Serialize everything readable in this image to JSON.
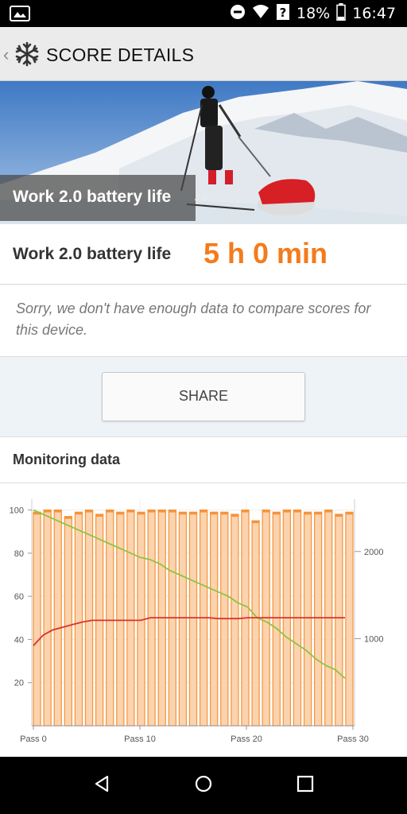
{
  "status_bar": {
    "battery_percent": "18%",
    "time": "16:47"
  },
  "app_bar": {
    "title": "SCORE DETAILS",
    "back_icon": "chevron-left-icon",
    "logo_icon": "snowflake-icon"
  },
  "hero": {
    "caption": "Work 2.0 battery life",
    "version": "2.0"
  },
  "result": {
    "label": "Work 2.0 battery life",
    "value": "5 h 0 min",
    "value_color": "#f47b1c"
  },
  "notice": {
    "text": "Sorry, we don't have enough data to compare scores for this device."
  },
  "share_button": {
    "label": "SHARE"
  },
  "monitoring": {
    "heading": "Monitoring data"
  },
  "chart_data": {
    "type": "bar",
    "x_tick_labels": [
      "Pass 0",
      "Pass 10",
      "Pass 20",
      "Pass 30"
    ],
    "left_axis": {
      "ticks": [
        20,
        40,
        60,
        80,
        100
      ],
      "ylim": [
        0,
        105
      ]
    },
    "right_axis": {
      "ticks": [
        1000,
        2000
      ],
      "ylim": [
        0,
        2600
      ]
    },
    "series": [
      {
        "type": "bar",
        "color": "#f5933a",
        "axis": "left",
        "values": [
          99,
          100,
          100,
          97,
          99,
          100,
          98,
          100,
          99,
          100,
          99,
          100,
          100,
          100,
          99,
          99,
          100,
          99,
          99,
          98,
          100,
          95,
          100,
          99,
          100,
          100,
          99,
          99,
          100,
          98,
          99
        ]
      },
      {
        "type": "line",
        "color": "#8cc63f",
        "axis": "left",
        "values": [
          100,
          98,
          96,
          94,
          92,
          90,
          88,
          86,
          84,
          82,
          80,
          78,
          77,
          75,
          72,
          70,
          68,
          66,
          64,
          62,
          60,
          57,
          55,
          50,
          48,
          45,
          41,
          38,
          35,
          31,
          28,
          26,
          22
        ]
      },
      {
        "type": "line",
        "color": "#d9342b",
        "axis": "right",
        "values": [
          920,
          1040,
          1100,
          1130,
          1160,
          1190,
          1210,
          1210,
          1210,
          1210,
          1210,
          1210,
          1240,
          1240,
          1240,
          1240,
          1240,
          1240,
          1240,
          1230,
          1230,
          1230,
          1240,
          1240,
          1240,
          1240,
          1240,
          1240,
          1240,
          1240,
          1240,
          1240,
          1240
        ]
      }
    ]
  }
}
